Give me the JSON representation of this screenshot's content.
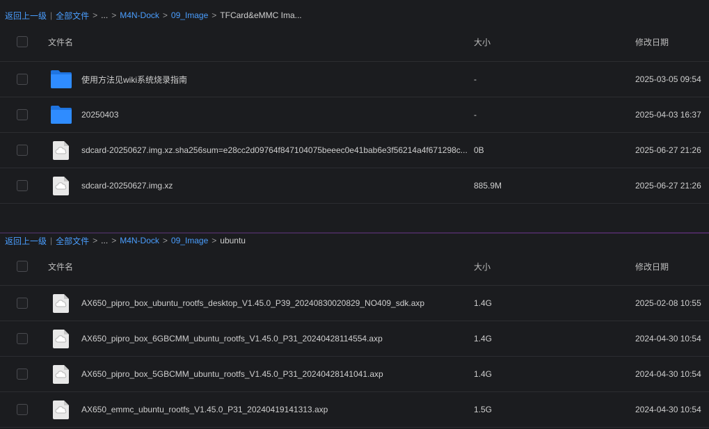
{
  "colors": {
    "background": "#1b1c1f",
    "link": "#4a9eff",
    "folder": "#2f8cff",
    "file": "#e8e8e8"
  },
  "panels": [
    {
      "breadcrumb": {
        "back": "返回上一级",
        "all_files": "全部文件",
        "ellipsis": "...",
        "crumbs": [
          "M4N-Dock",
          "09_Image"
        ],
        "current": "TFCard&eMMC Ima..."
      },
      "columns": {
        "name": "文件名",
        "size": "大小",
        "date": "修改日期"
      },
      "rows": [
        {
          "icon": "folder-icon",
          "name": "使用方法见wiki系统烧录指南",
          "size": "-",
          "date": "2025-03-05 09:54"
        },
        {
          "icon": "folder-icon",
          "name": "20250403",
          "size": "-",
          "date": "2025-04-03 16:37"
        },
        {
          "icon": "cloud-file-icon",
          "name": "sdcard-20250627.img.xz.sha256sum=e28cc2d09764f847104075beeec0e41bab6e3f56214a4f671298c...",
          "size": "0B",
          "date": "2025-06-27 21:26"
        },
        {
          "icon": "cloud-file-icon",
          "name": "sdcard-20250627.img.xz",
          "size": "885.9M",
          "date": "2025-06-27 21:26"
        }
      ]
    },
    {
      "breadcrumb": {
        "back": "返回上一级",
        "all_files": "全部文件",
        "ellipsis": "...",
        "crumbs": [
          "M4N-Dock",
          "09_Image"
        ],
        "current": "ubuntu"
      },
      "columns": {
        "name": "文件名",
        "size": "大小",
        "date": "修改日期"
      },
      "rows": [
        {
          "icon": "cloud-file-icon",
          "name": "AX650_pipro_box_ubuntu_rootfs_desktop_V1.45.0_P39_20240830020829_NO409_sdk.axp",
          "size": "1.4G",
          "date": "2025-02-08 10:55"
        },
        {
          "icon": "cloud-file-icon",
          "name": "AX650_pipro_box_6GBCMM_ubuntu_rootfs_V1.45.0_P31_20240428114554.axp",
          "size": "1.4G",
          "date": "2024-04-30 10:54"
        },
        {
          "icon": "cloud-file-icon",
          "name": "AX650_pipro_box_5GBCMM_ubuntu_rootfs_V1.45.0_P31_20240428141041.axp",
          "size": "1.4G",
          "date": "2024-04-30 10:54"
        },
        {
          "icon": "cloud-file-icon",
          "name": "AX650_emmc_ubuntu_rootfs_V1.45.0_P31_20240419141313.axp",
          "size": "1.5G",
          "date": "2024-04-30 10:54"
        }
      ]
    }
  ]
}
